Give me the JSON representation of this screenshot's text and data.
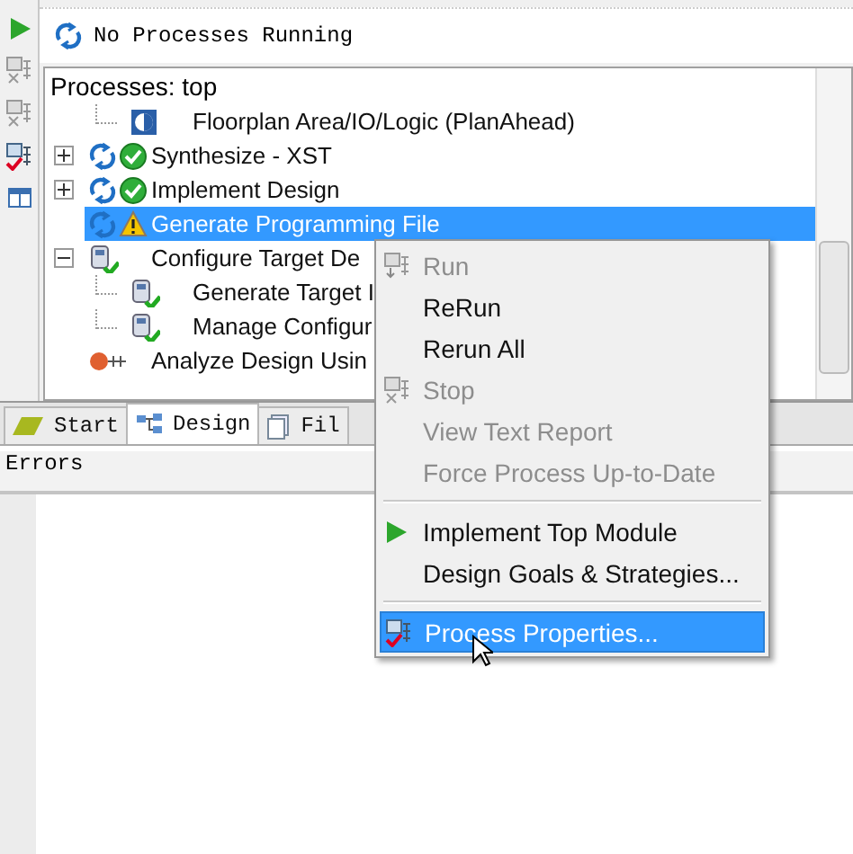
{
  "status": {
    "text": "No Processes Running"
  },
  "panel": {
    "title": "Processes: top"
  },
  "tree": {
    "items": [
      {
        "children": [
          {
            "label": "Floorplan Area/IO/Logic (PlanAhead)",
            "kind": "floorplan",
            "selected": false
          }
        ]
      },
      {
        "label": "Synthesize - XST",
        "kind": "done",
        "expanded": false,
        "selected": false
      },
      {
        "label": "Implement Design",
        "kind": "done",
        "expanded": false,
        "selected": false
      },
      {
        "label": "Generate Programming File",
        "kind": "warning",
        "selected": true
      },
      {
        "label": "Configure Target De",
        "kind": "device",
        "expanded": true,
        "selected": false,
        "children": [
          {
            "label": "Generate Target I",
            "kind": "device",
            "selected": false
          },
          {
            "label": "Manage Configur",
            "kind": "device",
            "selected": false
          }
        ]
      },
      {
        "label": "Analyze Design Usin",
        "kind": "probe",
        "selected": false
      }
    ]
  },
  "tabs": [
    {
      "label": "Start",
      "selected": false
    },
    {
      "label": "Design",
      "selected": true
    },
    {
      "label": "Fil",
      "selected": false
    }
  ],
  "errors": {
    "title": "Errors"
  },
  "menu": [
    {
      "kind": "run",
      "label": "Run",
      "disabled": true,
      "selected": false
    },
    {
      "kind": "plain",
      "label": "ReRun",
      "disabled": false,
      "selected": false
    },
    {
      "kind": "plain",
      "label": "Rerun All",
      "disabled": false,
      "selected": false
    },
    {
      "kind": "stop",
      "label": "Stop",
      "disabled": true,
      "selected": false
    },
    {
      "kind": "plain",
      "label": "View Text Report",
      "disabled": true,
      "selected": false
    },
    {
      "kind": "plain",
      "label": "Force Process Up-to-Date",
      "disabled": true,
      "selected": false
    },
    {
      "kind": "separator"
    },
    {
      "kind": "play",
      "label": "Implement Top Module",
      "disabled": false,
      "selected": false
    },
    {
      "kind": "plain",
      "label": "Design Goals & Strategies...",
      "disabled": false,
      "selected": false
    },
    {
      "kind": "separator"
    },
    {
      "kind": "properties",
      "label": "Process Properties...",
      "disabled": false,
      "selected": true
    }
  ]
}
